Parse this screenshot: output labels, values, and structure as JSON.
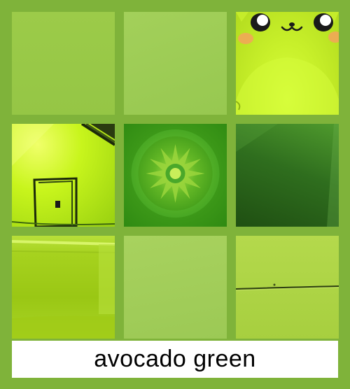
{
  "caption": {
    "text": "avocado green"
  },
  "palette": {
    "background": "#7fb33a",
    "caption_background": "#ffffff",
    "caption_text": "#000000"
  },
  "tiles": [
    {
      "name": "flat-green-swatch"
    },
    {
      "name": "light-green-paper-swatch"
    },
    {
      "name": "green-cartoon-cat"
    },
    {
      "name": "lime-painted-house"
    },
    {
      "name": "green-kaleidoscope-star"
    },
    {
      "name": "dark-green-canvas"
    },
    {
      "name": "lime-interior-wall"
    },
    {
      "name": "green-textured-paper"
    },
    {
      "name": "green-painted-wood-panel"
    }
  ]
}
